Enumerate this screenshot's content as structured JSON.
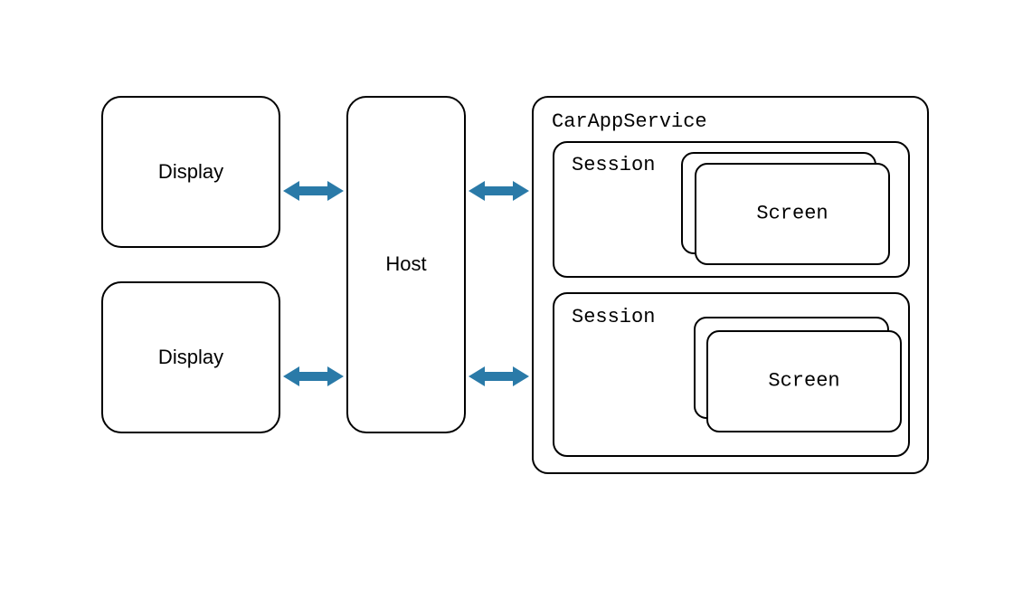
{
  "diagram": {
    "display_top": {
      "label": "Display"
    },
    "display_bottom": {
      "label": "Display"
    },
    "host": {
      "label": "Host"
    },
    "car_app_service": {
      "title": "CarAppService"
    },
    "session_top": {
      "title": "Session",
      "screen": {
        "label": "Screen"
      }
    },
    "session_bottom": {
      "title": "Session",
      "screen": {
        "label": "Screen"
      }
    },
    "arrow_color": "#2a7aa8"
  }
}
